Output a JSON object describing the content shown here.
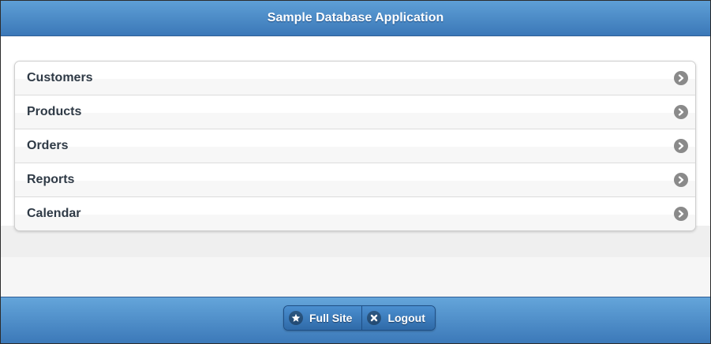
{
  "header": {
    "title": "Sample Database Application"
  },
  "menu": {
    "items": [
      {
        "label": "Customers",
        "icon": "chevron-right-icon"
      },
      {
        "label": "Products",
        "icon": "chevron-right-icon"
      },
      {
        "label": "Orders",
        "icon": "chevron-right-icon"
      },
      {
        "label": "Reports",
        "icon": "chevron-right-icon"
      },
      {
        "label": "Calendar",
        "icon": "chevron-right-icon"
      }
    ]
  },
  "footer": {
    "full_site_label": "Full Site",
    "full_site_icon": "star-icon",
    "logout_label": "Logout",
    "logout_icon": "close-icon"
  },
  "colors": {
    "header_blue": "#3b78b8",
    "list_text": "#2f3a46",
    "arrow_grey": "#8a8a8a"
  }
}
